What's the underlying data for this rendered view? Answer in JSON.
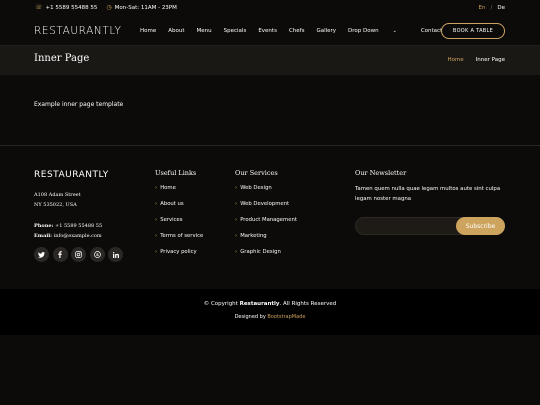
{
  "topbar": {
    "phone": "+1 5589 55488 55",
    "hours": "Mon-Sat: 11AM - 23PM",
    "phone_icon": "phone-icon",
    "clock_icon": "clock-icon",
    "lang_en": "En",
    "lang_sep": "/",
    "lang_de": "De"
  },
  "header": {
    "logo": "RESTAURANTLY",
    "nav": [
      "Home",
      "About",
      "Menu",
      "Specials",
      "Events",
      "Chefs",
      "Gallery",
      "Drop Down",
      "Contact"
    ],
    "book_button": "BOOK A TABLE"
  },
  "breadcrumbs": {
    "title": "Inner Page",
    "home": "Home",
    "current": "Inner Page"
  },
  "main": {
    "text": "Example inner page template"
  },
  "footer": {
    "brand": "RESTAURANTLY",
    "address_line1": "A108 Adam Street",
    "address_line2": "NY 535022, USA",
    "phone_label": "Phone:",
    "phone_value": "+1 5589 55488 55",
    "email_label": "Email:",
    "email_value": "info@example.com",
    "socials": [
      "twitter-icon",
      "facebook-icon",
      "instagram-icon",
      "skype-icon",
      "linkedin-icon"
    ],
    "useful_links_title": "Useful Links",
    "useful_links": [
      "Home",
      "About us",
      "Services",
      "Terms of service",
      "Privacy policy"
    ],
    "services_title": "Our Services",
    "services": [
      "Web Design",
      "Web Development",
      "Product Management",
      "Marketing",
      "Graphic Design"
    ],
    "newsletter_title": "Our Newsletter",
    "newsletter_text": "Tamen quem nulla quae legam multos aute sint culpa legam noster magna",
    "subscribe": "Subscribe"
  },
  "copyright": {
    "prefix": "© Copyright ",
    "brand": "Restaurantly",
    "suffix": ". All Rights Reserved",
    "designed_by": "Designed by ",
    "designer": "BootstrapMade"
  },
  "colors": {
    "accent": "#cda45e",
    "background": "#0d0b09"
  }
}
